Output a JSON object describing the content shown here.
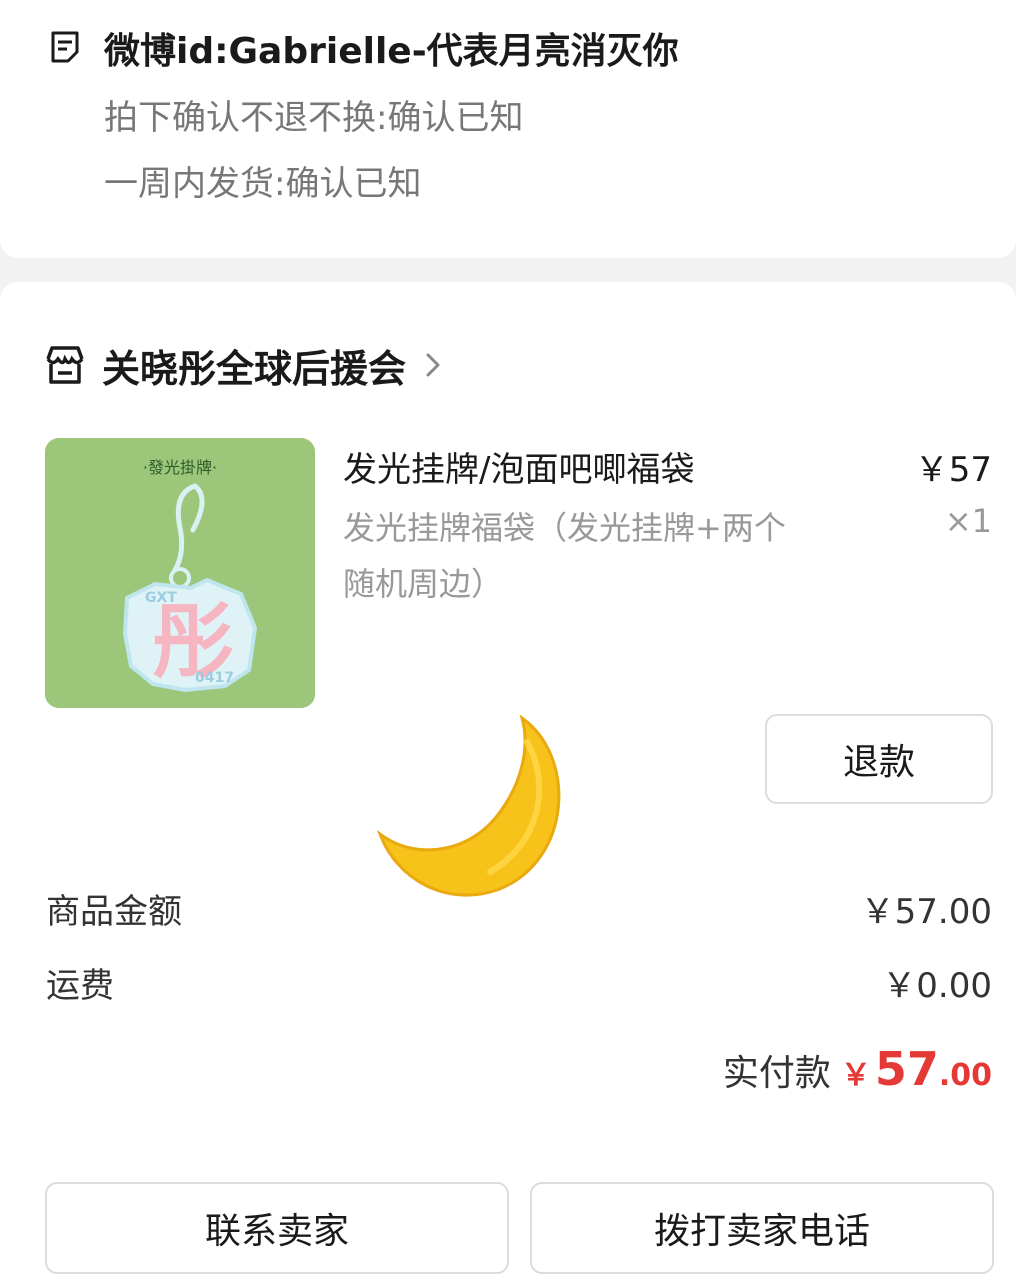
{
  "note": {
    "icon": "note-icon",
    "title": "微博id:Gabrielle-代表月亮消灭你",
    "lines": [
      "拍下确认不退不换:确认已知",
      "一周内发货:确认已知"
    ]
  },
  "shop": {
    "icon": "store-icon",
    "name": "关晓彤全球后援会"
  },
  "product": {
    "name": "发光挂牌/泡面吧唧福袋",
    "spec": "发光挂牌福袋（发光挂牌+两个随机周边）",
    "price": "￥57",
    "quantity": "×1",
    "image": {
      "caption": "·發光掛牌·",
      "glyph": "彤",
      "tag_left": "GXT",
      "tag_right": "0417"
    }
  },
  "refund_button": "退款",
  "summary": {
    "goods_label": "商品金额",
    "goods_value": "￥57.00",
    "shipping_label": "运费",
    "shipping_value": "￥0.00",
    "paid_label": "实付款",
    "paid_currency": "￥",
    "paid_integer": "57",
    "paid_decimal": ".00"
  },
  "actions": {
    "contact_seller": "联系卖家",
    "call_seller": "拨打卖家电话"
  },
  "colors": {
    "price_red": "#e53935",
    "moon_yellow": "#f7c21a",
    "thumb_green": "#9cc77a"
  }
}
